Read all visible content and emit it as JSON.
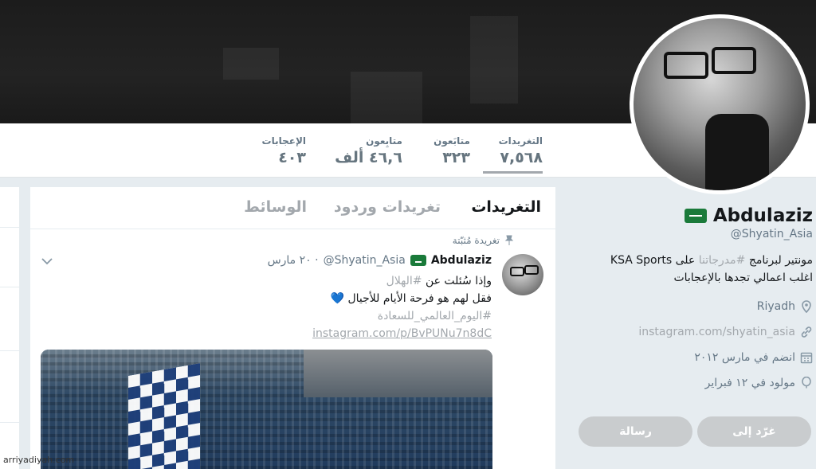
{
  "stats": [
    {
      "label": "التغريدات",
      "value": "٧,٥٦٨",
      "active": true
    },
    {
      "label": "متابَعون",
      "value": "٣٢٣",
      "active": false
    },
    {
      "label": "متابِعون",
      "value": "٤٦,٦ ألف",
      "active": false
    },
    {
      "label": "الإعجابات",
      "value": "٤٠٣",
      "active": false
    }
  ],
  "profile": {
    "name": "Abdulaziz",
    "handle": "@Shyatin_Asia",
    "bio_part1": "مونتير لبرنامج ",
    "bio_tag": "#مدرجاتنا",
    "bio_part2": " على KSA Sports",
    "bio_line2": "اغلب اعمالي تجدها بالإعجابات",
    "location": "Riyadh",
    "website": "instagram.com/shyatin_asia",
    "joined": "انضم في مارس ٢٠١٢",
    "born": "مولود في ١٢ فبراير",
    "icons": {
      "location": "location-pin-icon",
      "website": "link-icon",
      "joined": "calendar-icon",
      "born": "balloon-icon",
      "flag": "saudi-flag-icon"
    }
  },
  "buttons": {
    "tweet_to": "غرّد إلى",
    "message": "رسالة"
  },
  "tabs": [
    {
      "label": "التغريدات",
      "active": true
    },
    {
      "label": "تغريدات وردود",
      "active": false
    },
    {
      "label": "الوسائط",
      "active": false
    }
  ],
  "tweet": {
    "pinned_label": "تغريدة مُثبّتة",
    "name": "Abdulaziz",
    "handle": "@Shyatin_Asia",
    "date": "· ٢٠ مارس",
    "line1_text": "وإذا سُئلت عن ",
    "line1_tag": "#الهلال",
    "line2": "فقل لهم هو فرحة الأيام للأجيال 💙",
    "line3_tag": "#اليوم_العالمي_للسعادة",
    "url": "instagram.com/p/BvPUNu7n8dC"
  },
  "watermark": "arriyadiyah.com"
}
